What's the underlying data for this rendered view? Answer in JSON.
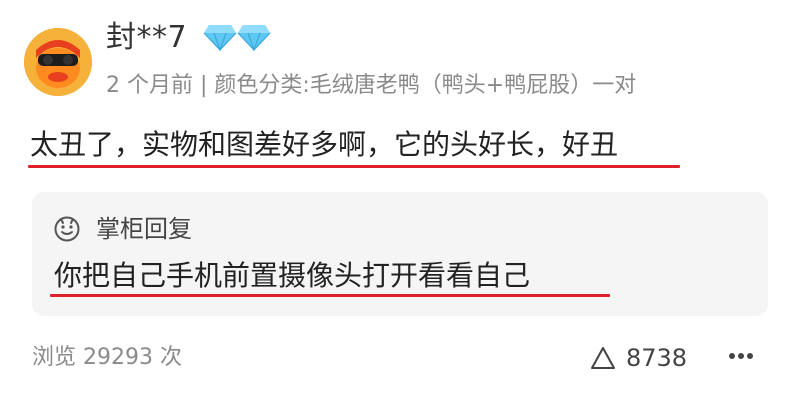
{
  "user": {
    "name": "封**7",
    "avatar_icon": "duck-avatar-icon",
    "badge_icons": [
      "diamond-icon",
      "diamond-icon"
    ],
    "badge_color": "#5ec8f2"
  },
  "meta": {
    "text": "2 个月前 | 颜色分类:毛绒唐老鸭（鸭头+鸭屁股）一对"
  },
  "comment": {
    "text": "太丑了，实物和图差好多啊，它的头好长，好丑"
  },
  "reply": {
    "icon": "smiley-face-icon",
    "title": "掌柜回复",
    "text": "你把自己手机前置摄像头打开看看自己"
  },
  "footer": {
    "views": "浏览 29293 次",
    "like_icon": "triangle-up-icon",
    "like_count": "8738",
    "more_icon": "more-dots-icon"
  },
  "colors": {
    "underline": "#e0202a",
    "reply_bg": "#f5f5f5",
    "meta_text": "#8a8a8a"
  }
}
